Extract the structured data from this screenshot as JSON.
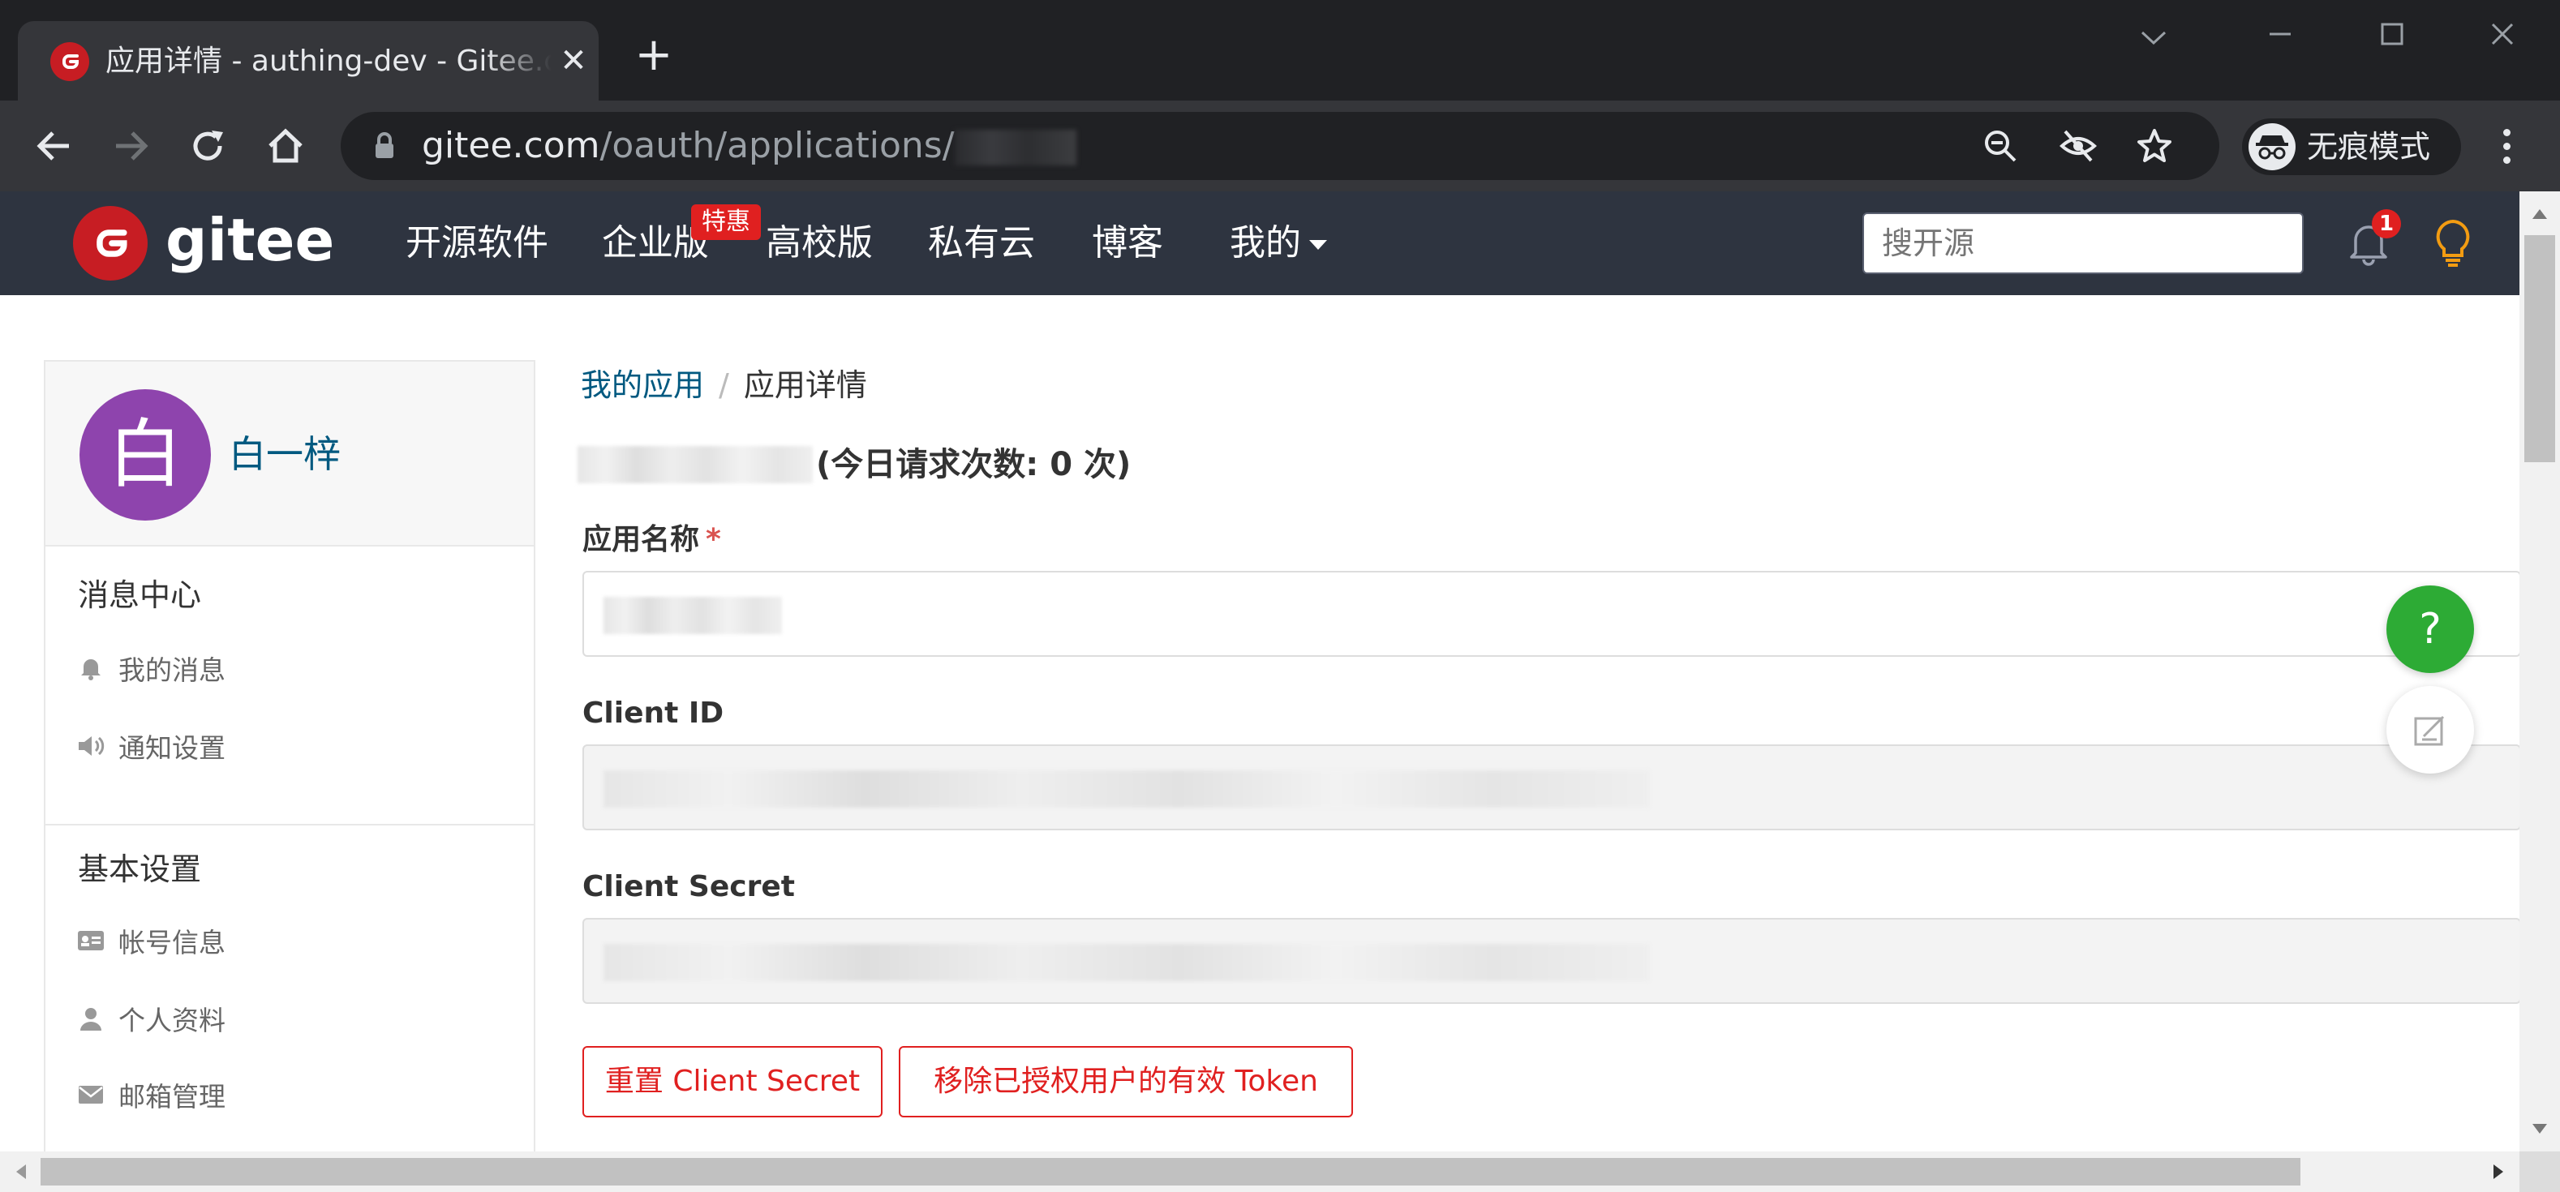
{
  "browser": {
    "tab_title": "应用详情 - authing-dev - Gitee.com",
    "tab_close": "✕",
    "new_tab": "+",
    "url_host": "gitee.com",
    "url_path": "/oauth/applications/",
    "incognito_label": "无痕模式",
    "window_controls": {
      "dropdown": "⌵",
      "minimize": "—",
      "maximize": "☐",
      "close": "✕"
    }
  },
  "header": {
    "logo_text": "gitee",
    "nav": [
      {
        "label": "开源软件"
      },
      {
        "label": "企业版"
      },
      {
        "label": "高校版"
      },
      {
        "label": "私有云"
      },
      {
        "label": "博客"
      },
      {
        "label": "我的"
      }
    ],
    "hot_badge": "特惠",
    "search_placeholder": "搜开源",
    "notification_count": "1"
  },
  "sidebar": {
    "avatar_char": "白",
    "user_name": "白一梓",
    "sections": [
      {
        "title": "消息中心",
        "items": [
          {
            "label": "我的消息",
            "icon": "bell-icon"
          },
          {
            "label": "通知设置",
            "icon": "megaphone-icon"
          }
        ]
      },
      {
        "title": "基本设置",
        "items": [
          {
            "label": "帐号信息",
            "icon": "id-card-icon"
          },
          {
            "label": "个人资料",
            "icon": "user-icon"
          },
          {
            "label": "邮箱管理",
            "icon": "envelope-icon"
          }
        ]
      }
    ]
  },
  "main": {
    "breadcrumb": {
      "parent": "我的应用",
      "separator": "/",
      "current": "应用详情"
    },
    "request_stat": "(今日请求次数: 0 次)",
    "fields": {
      "app_name_label": "应用名称",
      "required_mark": "*",
      "client_id_label": "Client ID",
      "client_secret_label": "Client Secret"
    },
    "buttons": {
      "reset_secret": "重置 Client Secret",
      "revoke_tokens": "移除已授权用户的有效 Token"
    }
  },
  "floating": {
    "help": "?"
  },
  "colors": {
    "header_bg": "#2e3440",
    "brand_red": "#c71d23",
    "link_blue": "#005980",
    "danger": "#e02020",
    "help_green": "#2dab35",
    "avatar_purple": "#8e44ad"
  }
}
